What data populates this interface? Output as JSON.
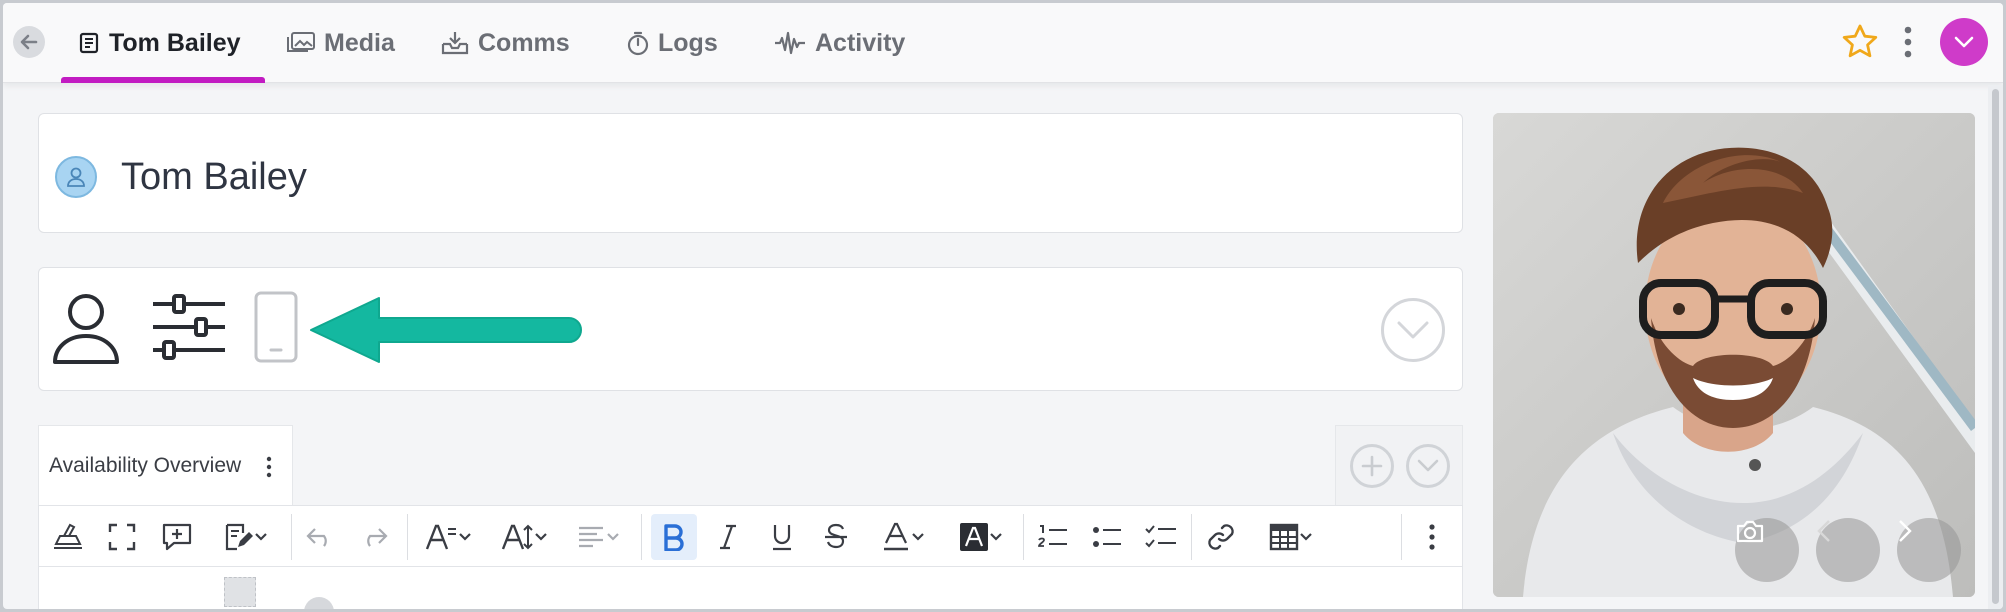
{
  "tabs": [
    {
      "label": "Tom Bailey",
      "icon": "document-icon",
      "active": true
    },
    {
      "label": "Media",
      "icon": "image-icon",
      "active": false
    },
    {
      "label": "Comms",
      "icon": "inbox-icon",
      "active": false
    },
    {
      "label": "Logs",
      "icon": "stopwatch-icon",
      "active": false
    },
    {
      "label": "Activity",
      "icon": "waveform-icon",
      "active": false
    }
  ],
  "colors": {
    "accent": "#c21cc2",
    "avatar_menu": "#cf3bc9",
    "star": "#f0a81a",
    "arrow": "#14b8a0",
    "bold_active": "#2a6fd6"
  },
  "record": {
    "name": "Tom Bailey"
  },
  "icons_row": [
    "person-icon",
    "sliders-icon",
    "mobile-phone-icon",
    "chevron-down-circle-icon"
  ],
  "availability": {
    "label": "Availability Overview"
  },
  "toolbar_icons": [
    "clear-format-icon",
    "fullscreen-icon",
    "insert-comment-icon",
    "edit-icon",
    "undo-icon",
    "redo-icon",
    "font-family-icon",
    "font-size-icon",
    "align-icon",
    "bold-icon",
    "italic-icon",
    "underline-icon",
    "strikethrough-icon",
    "text-color-icon",
    "highlight-color-icon",
    "ordered-list-icon",
    "bullet-list-icon",
    "checklist-icon",
    "link-icon",
    "table-icon",
    "more-icon"
  ]
}
